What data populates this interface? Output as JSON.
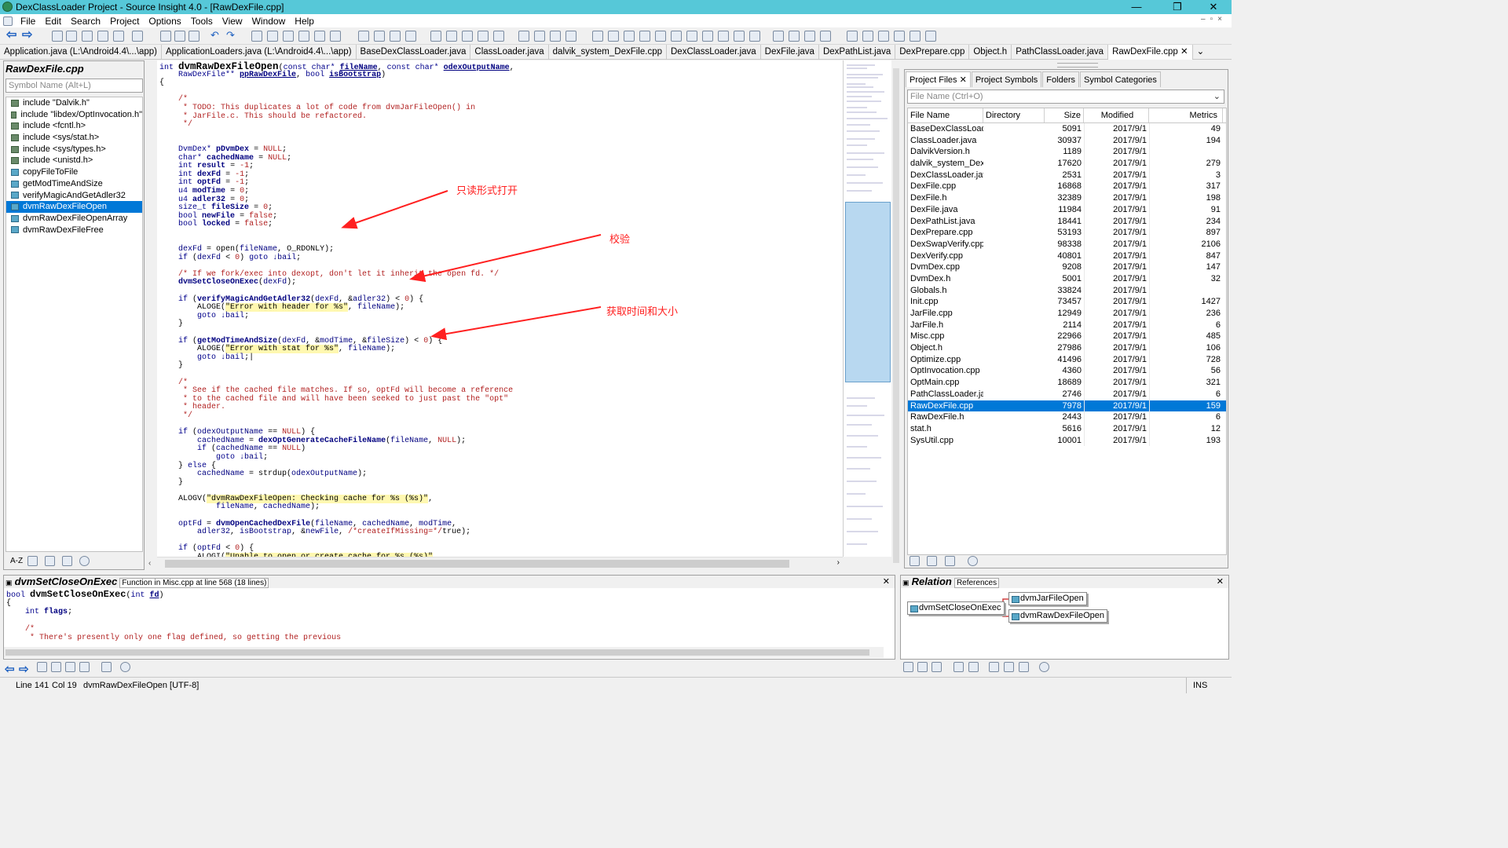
{
  "window": {
    "title": "DexClassLoader Project - Source Insight 4.0 - [RawDexFile.cpp]",
    "controls": [
      "—",
      "❐",
      "✕"
    ]
  },
  "menu": [
    "File",
    "Edit",
    "Search",
    "Project",
    "Options",
    "Tools",
    "View",
    "Window",
    "Help"
  ],
  "tabs": [
    "Application.java (L:\\Android4.4\\...\\app)",
    "ApplicationLoaders.java (L:\\Android4.4\\...\\app)",
    "BaseDexClassLoader.java",
    "ClassLoader.java",
    "dalvik_system_DexFile.cpp",
    "DexClassLoader.java",
    "DexFile.java",
    "DexPathList.java",
    "DexPrepare.cpp",
    "Object.h",
    "PathClassLoader.java",
    "RawDexFile.cpp"
  ],
  "active_tab_index": 11,
  "symbol_pane": {
    "file_name": "RawDexFile.cpp",
    "search_placeholder": "Symbol Name (Alt+L)",
    "items": [
      {
        "label": "include \"Dalvik.h\"",
        "kind": "include"
      },
      {
        "label": "include \"libdex/OptInvocation.h\"",
        "kind": "include"
      },
      {
        "label": "include <fcntl.h>",
        "kind": "include"
      },
      {
        "label": "include <sys/stat.h>",
        "kind": "include"
      },
      {
        "label": "include <sys/types.h>",
        "kind": "include"
      },
      {
        "label": "include <unistd.h>",
        "kind": "include"
      },
      {
        "label": "copyFileToFile",
        "kind": "function"
      },
      {
        "label": "getModTimeAndSize",
        "kind": "function"
      },
      {
        "label": "verifyMagicAndGetAdler32",
        "kind": "function"
      },
      {
        "label": "dvmRawDexFileOpen",
        "kind": "function",
        "selected": true
      },
      {
        "label": "dvmRawDexFileOpenArray",
        "kind": "function"
      },
      {
        "label": "dvmRawDexFileFree",
        "kind": "function"
      }
    ]
  },
  "annotations": {
    "readonly_open": "只读形式打开",
    "verify": "校验",
    "get_time_size": "获取时间和大小"
  },
  "project_pane": {
    "tabs": [
      "Project Files",
      "Project Symbols",
      "Folders",
      "Symbol Categories"
    ],
    "close_glyph": "✕",
    "search_placeholder": "File Name (Ctrl+O)",
    "columns": [
      "File Name",
      "Directory",
      "Size",
      "Modified",
      "Metrics"
    ],
    "rows": [
      {
        "name": "BaseDexClassLoade",
        "size": "5091",
        "modified": "2017/9/1",
        "metrics": "49"
      },
      {
        "name": "ClassLoader.java",
        "size": "30937",
        "modified": "2017/9/1",
        "metrics": "194"
      },
      {
        "name": "DalvikVersion.h",
        "size": "1189",
        "modified": "2017/9/1",
        "metrics": ""
      },
      {
        "name": "dalvik_system_DexFil",
        "size": "17620",
        "modified": "2017/9/1",
        "metrics": "279"
      },
      {
        "name": "DexClassLoader.java",
        "size": "2531",
        "modified": "2017/9/1",
        "metrics": "3"
      },
      {
        "name": "DexFile.cpp",
        "size": "16868",
        "modified": "2017/9/1",
        "metrics": "317"
      },
      {
        "name": "DexFile.h",
        "size": "32389",
        "modified": "2017/9/1",
        "metrics": "198"
      },
      {
        "name": "DexFile.java",
        "size": "11984",
        "modified": "2017/9/1",
        "metrics": "91"
      },
      {
        "name": "DexPathList.java",
        "size": "18441",
        "modified": "2017/9/1",
        "metrics": "234"
      },
      {
        "name": "DexPrepare.cpp",
        "size": "53193",
        "modified": "2017/9/1",
        "metrics": "897"
      },
      {
        "name": "DexSwapVerify.cpp",
        "size": "98338",
        "modified": "2017/9/1",
        "metrics": "2106"
      },
      {
        "name": "DexVerify.cpp",
        "size": "40801",
        "modified": "2017/9/1",
        "metrics": "847"
      },
      {
        "name": "DvmDex.cpp",
        "size": "9208",
        "modified": "2017/9/1",
        "metrics": "147"
      },
      {
        "name": "DvmDex.h",
        "size": "5001",
        "modified": "2017/9/1",
        "metrics": "32"
      },
      {
        "name": "Globals.h",
        "size": "33824",
        "modified": "2017/9/1",
        "metrics": ""
      },
      {
        "name": "Init.cpp",
        "size": "73457",
        "modified": "2017/9/1",
        "metrics": "1427"
      },
      {
        "name": "JarFile.cpp",
        "size": "12949",
        "modified": "2017/9/1",
        "metrics": "236"
      },
      {
        "name": "JarFile.h",
        "size": "2114",
        "modified": "2017/9/1",
        "metrics": "6"
      },
      {
        "name": "Misc.cpp",
        "size": "22966",
        "modified": "2017/9/1",
        "metrics": "485"
      },
      {
        "name": "Object.h",
        "size": "27986",
        "modified": "2017/9/1",
        "metrics": "106"
      },
      {
        "name": "Optimize.cpp",
        "size": "41496",
        "modified": "2017/9/1",
        "metrics": "728"
      },
      {
        "name": "OptInvocation.cpp",
        "size": "4360",
        "modified": "2017/9/1",
        "metrics": "56"
      },
      {
        "name": "OptMain.cpp",
        "size": "18689",
        "modified": "2017/9/1",
        "metrics": "321"
      },
      {
        "name": "PathClassLoader.javi",
        "size": "2746",
        "modified": "2017/9/1",
        "metrics": "6"
      },
      {
        "name": "RawDexFile.cpp",
        "size": "7978",
        "modified": "2017/9/1",
        "metrics": "159",
        "selected": true
      },
      {
        "name": "RawDexFile.h",
        "size": "2443",
        "modified": "2017/9/1",
        "metrics": "6"
      },
      {
        "name": "stat.h",
        "size": "5616",
        "modified": "2017/9/1",
        "metrics": "12"
      },
      {
        "name": "SysUtil.cpp",
        "size": "10001",
        "modified": "2017/9/1",
        "metrics": "193"
      }
    ]
  },
  "context_pane": {
    "symbol": "dvmSetCloseOnExec",
    "info": "Function in Misc.cpp at line 568 (18 lines)"
  },
  "relation_pane": {
    "title": "Relation",
    "mode": "References",
    "root": "dvmSetCloseOnExec",
    "children": [
      "dvmJarFileOpen",
      "dvmRawDexFileOpen"
    ]
  },
  "status": {
    "line": "Line 141",
    "col": "Col 19",
    "func": "dvmRawDexFileOpen [UTF-8]",
    "ins": "INS"
  },
  "colors": {
    "titlebar": "#56c8d8",
    "selection": "#0078d7",
    "annotation": "#ff2020"
  }
}
